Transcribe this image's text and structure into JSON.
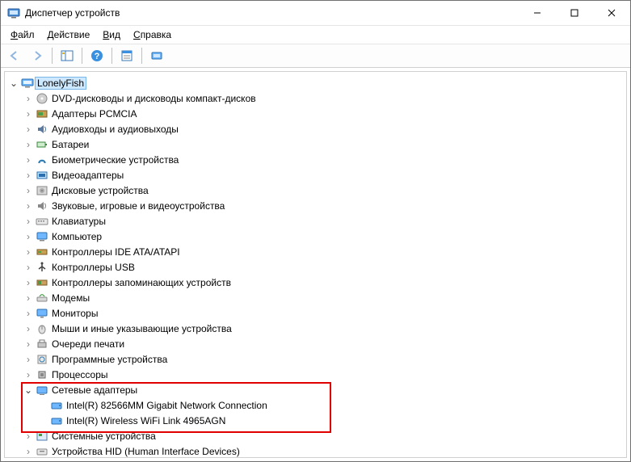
{
  "window": {
    "title": "Диспетчер устройств"
  },
  "menu": {
    "file": {
      "label": "Файл",
      "ul": "Ф"
    },
    "action": {
      "label": "Действие",
      "ul": "Д"
    },
    "view": {
      "label": "Вид",
      "ul": "В"
    },
    "help": {
      "label": "Справка",
      "ul": "С"
    }
  },
  "tree": {
    "root": {
      "label": "LonelyFish"
    },
    "items": [
      {
        "label": "DVD-дисководы и дисководы компакт-дисков",
        "icon": "disc"
      },
      {
        "label": "Адаптеры PCMCIA",
        "icon": "pcmcia"
      },
      {
        "label": "Аудиовходы и аудиовыходы",
        "icon": "audio"
      },
      {
        "label": "Батареи",
        "icon": "battery"
      },
      {
        "label": "Биометрические устройства",
        "icon": "biometric"
      },
      {
        "label": "Видеоадаптеры",
        "icon": "video"
      },
      {
        "label": "Дисковые устройства",
        "icon": "disk"
      },
      {
        "label": "Звуковые, игровые и видеоустройства",
        "icon": "sound"
      },
      {
        "label": "Клавиатуры",
        "icon": "keyboard"
      },
      {
        "label": "Компьютер",
        "icon": "computer"
      },
      {
        "label": "Контроллеры IDE ATA/ATAPI",
        "icon": "ide"
      },
      {
        "label": "Контроллеры USB",
        "icon": "usb"
      },
      {
        "label": "Контроллеры запоминающих устройств",
        "icon": "storage"
      },
      {
        "label": "Модемы",
        "icon": "modem"
      },
      {
        "label": "Мониторы",
        "icon": "monitor"
      },
      {
        "label": "Мыши и иные указывающие устройства",
        "icon": "mouse"
      },
      {
        "label": "Очереди печати",
        "icon": "printer"
      },
      {
        "label": "Программные устройства",
        "icon": "software"
      },
      {
        "label": "Процессоры",
        "icon": "cpu"
      }
    ],
    "network": {
      "label": "Сетевые адаптеры",
      "children": [
        {
          "label": "Intel(R) 82566MM Gigabit Network Connection"
        },
        {
          "label": "Intel(R) Wireless WiFi Link 4965AGN"
        }
      ]
    },
    "after": [
      {
        "label": "Системные устройства",
        "icon": "system"
      },
      {
        "label": "Устройства HID (Human Interface Devices)",
        "icon": "hid"
      }
    ]
  }
}
